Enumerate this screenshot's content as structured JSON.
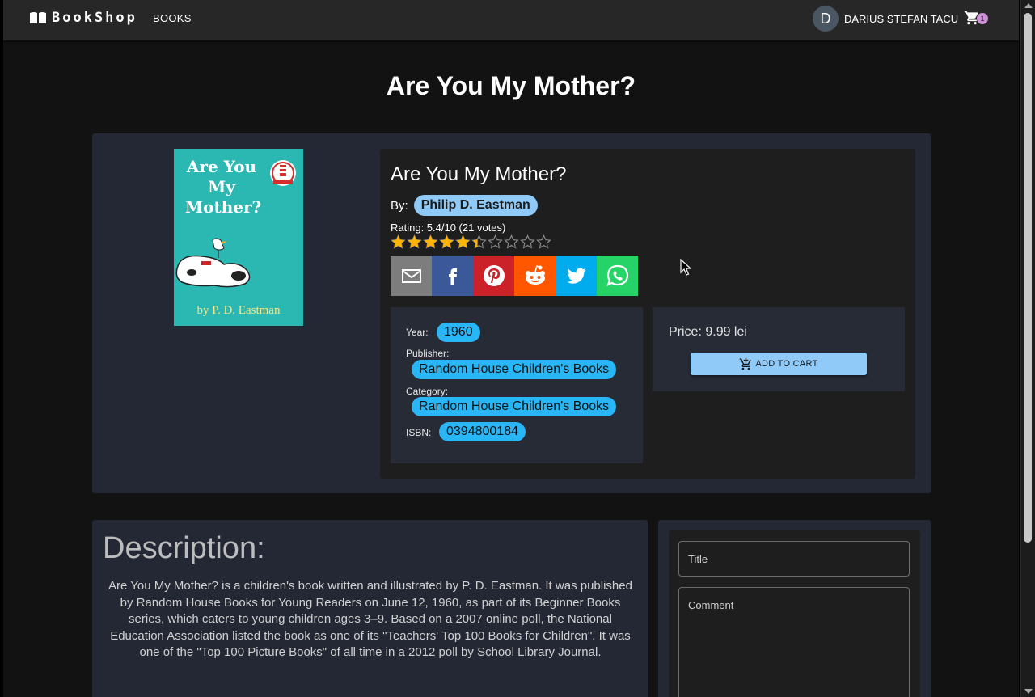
{
  "app": {
    "brand": "BookShop",
    "nav_books": "BOOKS"
  },
  "user": {
    "initial": "D",
    "name": "DARIUS STEFAN TACU"
  },
  "cart": {
    "count": "1"
  },
  "page": {
    "title": "Are You My Mother?"
  },
  "book": {
    "cover": {
      "title": "Are You My Mother?",
      "author": "by P. D. Eastman"
    },
    "title": "Are You My Mother?",
    "by_label": "By:",
    "author": "Philip D. Eastman",
    "rating_text": "Rating: 5.4/10 (21 votes)",
    "rating_value": 5.4,
    "rating_max": 10,
    "share": [
      {
        "name": "email",
        "color": "#7d7d7d"
      },
      {
        "name": "facebook",
        "color": "#3b5998"
      },
      {
        "name": "pinterest",
        "color": "#cb2128"
      },
      {
        "name": "reddit",
        "color": "#ff5700"
      },
      {
        "name": "twitter",
        "color": "#00aced"
      },
      {
        "name": "whatsapp",
        "color": "#25d366"
      }
    ],
    "meta": {
      "year_label": "Year:",
      "year": "1960",
      "publisher_label": "Publisher:",
      "publisher": "Random House Children's Books",
      "category_label": "Category:",
      "category": "Random House Children's Books",
      "isbn_label": "ISBN:",
      "isbn": "0394800184"
    },
    "price": "Price: 9.99 lei",
    "add_to_cart": "ADD TO CART"
  },
  "description": {
    "heading": "Description:",
    "text": "Are You My Mother? is a children's book written and illustrated by P. D. Eastman. It was published by Random House Books for Young Readers on June 12, 1960, as part of its Beginner Books series, which caters to young children ages 3–9. Based on a 2007 online poll, the National Education Association listed the book as one of its \"Teachers' Top 100 Books for Children\". It was one of the \"Top 100 Picture Books\" of all time in a 2012 poll by School Library Journal."
  },
  "review": {
    "title_placeholder": "Title",
    "comment_placeholder": "Comment"
  },
  "colors": {
    "accent": "#90caf9",
    "chip": "#29b6f6",
    "star": "#ffb400",
    "badge": "#ce93d8"
  }
}
